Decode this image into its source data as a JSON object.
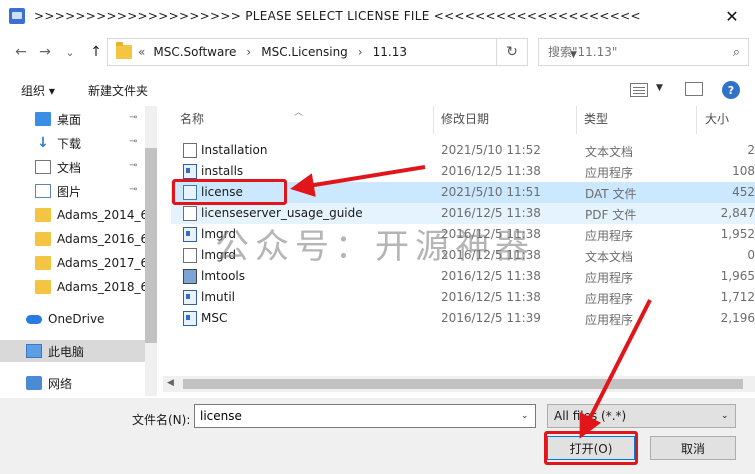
{
  "window": {
    "title": ">>>>>>>>>>>>>>>>>>>>  PLEASE SELECT LICENSE FILE  <<<<<<<<<<<<<<<<<<<<",
    "close_glyph": "✕"
  },
  "nav": {
    "back": "←",
    "forward": "→",
    "dropdown": "⌄",
    "up": "↑",
    "crumb_prefix": "«",
    "breadcrumbs": [
      "MSC.Software",
      "MSC.Licensing",
      "11.13"
    ],
    "crumb_separator": "›",
    "refresh_glyph": "↻",
    "search_placeholder": "搜索\"11.13\"",
    "search_glyph": "⌕"
  },
  "toolbar": {
    "organize": "组织 ▾",
    "new_folder": "新建文件夹",
    "help": "?"
  },
  "sidebar": {
    "items": [
      {
        "label": "桌面",
        "icon": "desktop-icon",
        "pinned": true
      },
      {
        "label": "下载",
        "icon": "download-icon",
        "pinned": true
      },
      {
        "label": "文档",
        "icon": "document-icon",
        "pinned": true
      },
      {
        "label": "图片",
        "icon": "picture-icon",
        "pinned": true
      },
      {
        "label": "Adams_2014_6",
        "icon": "folder-icon"
      },
      {
        "label": "Adams_2016_6",
        "icon": "folder-icon"
      },
      {
        "label": "Adams_2017_6",
        "icon": "folder-icon"
      },
      {
        "label": "Adams_2018_6",
        "icon": "folder-icon"
      },
      {
        "label": "OneDrive",
        "icon": "onedrive-icon"
      },
      {
        "label": "此电脑",
        "icon": "computer-icon",
        "selected": true
      },
      {
        "label": "网络",
        "icon": "network-icon"
      }
    ],
    "pin_glyph": "📌"
  },
  "columns": {
    "name": "名称",
    "modified": "修改日期",
    "type": "类型",
    "size": "大小"
  },
  "files": [
    {
      "name": "Installation",
      "date": "2021/5/10 11:52",
      "type": "文本文档",
      "size": "2",
      "icon": "text"
    },
    {
      "name": "installs",
      "date": "2016/12/5 11:38",
      "type": "应用程序",
      "size": "108",
      "icon": "app"
    },
    {
      "name": "license",
      "date": "2021/5/10 11:51",
      "type": "DAT 文件",
      "size": "452",
      "icon": "dat",
      "selected": true
    },
    {
      "name": "licenseserver_usage_guide",
      "date": "2016/12/5 11:38",
      "type": "PDF 文件",
      "size": "2,847",
      "icon": "text"
    },
    {
      "name": "lmgrd",
      "date": "2016/12/5 11:38",
      "type": "应用程序",
      "size": "1,952",
      "icon": "app"
    },
    {
      "name": "lmgrd",
      "date": "2016/12/5 11:38",
      "type": "文本文档",
      "size": "0",
      "icon": "text"
    },
    {
      "name": "lmtools",
      "date": "2016/12/5 11:38",
      "type": "应用程序",
      "size": "1,965",
      "icon": "gear"
    },
    {
      "name": "lmutil",
      "date": "2016/12/5 11:38",
      "type": "应用程序",
      "size": "1,712",
      "icon": "app"
    },
    {
      "name": "MSC",
      "date": "2016/12/5 11:39",
      "type": "应用程序",
      "size": "2,196",
      "icon": "app"
    }
  ],
  "watermark": "公众号：开源神器",
  "footer": {
    "filename_label": "文件名(N):",
    "filename_value": "license",
    "filter_value": "All files (*.*)",
    "open_button": "打开(O)",
    "cancel_button": "取消"
  },
  "colors": {
    "selection": "#cce8ff",
    "annotation_red": "#e0161a",
    "accent": "#0078d7"
  }
}
